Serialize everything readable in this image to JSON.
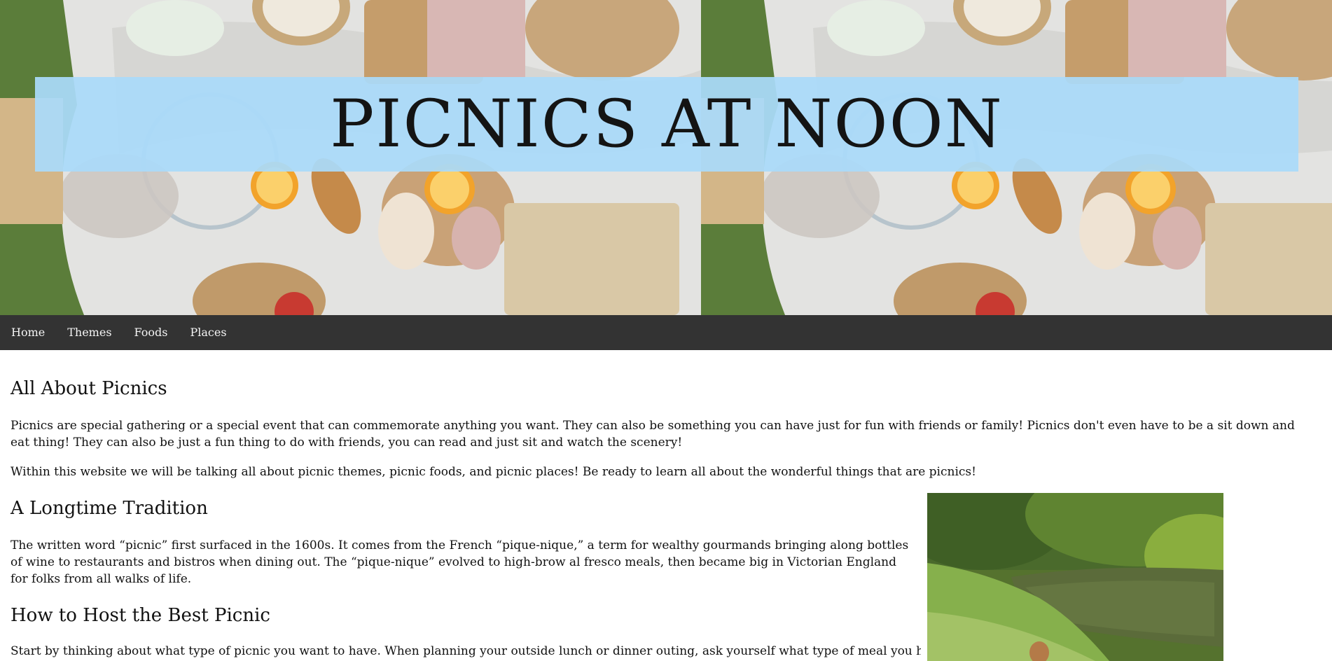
{
  "header": {
    "title": "Picnics at Noon",
    "hero_image": "picnic-spread-photo"
  },
  "nav": {
    "items": [
      {
        "label": "Home"
      },
      {
        "label": "Themes"
      },
      {
        "label": "Foods"
      },
      {
        "label": "Places"
      }
    ]
  },
  "main": {
    "about": {
      "heading": "All About Picnics",
      "paragraph1": "Picnics are special gathering or a special event that can commemorate anything you want. They can also be something you can have just for fun with friends or family! Picnics don't even have to be a sit down and eat thing! They can also be just a fun thing to do with friends, you can read and just sit and watch the scenery!",
      "paragraph2": "Within this website we will be talking all about picnic themes, picnic foods, and picnic places! Be ready to learn all about the wonderful things that are picnics!"
    },
    "tradition": {
      "heading": "A Longtime Tradition",
      "paragraph": "The written word “picnic” first surfaced in the 1600s. It comes from the French “pique-nique,” a term for wealthy gourmands bringing along bottles of wine to restaurants and bistros when dining out. The “pique-nique” evolved to high-brow al fresco meals, then became big in Victorian England for folks from all walks of life.",
      "image": "lakeside-picnic-photo"
    },
    "host": {
      "heading": "How to Host the Best Picnic",
      "paragraph": "Start by thinking about what type of picnic you want to have. When planning your outside lunch or dinner outing, ask yourself what type of meal you have in mind:"
    }
  },
  "colors": {
    "title_band": "#aadafa",
    "navbar": "#333333",
    "nav_text": "#f4f4f4"
  }
}
